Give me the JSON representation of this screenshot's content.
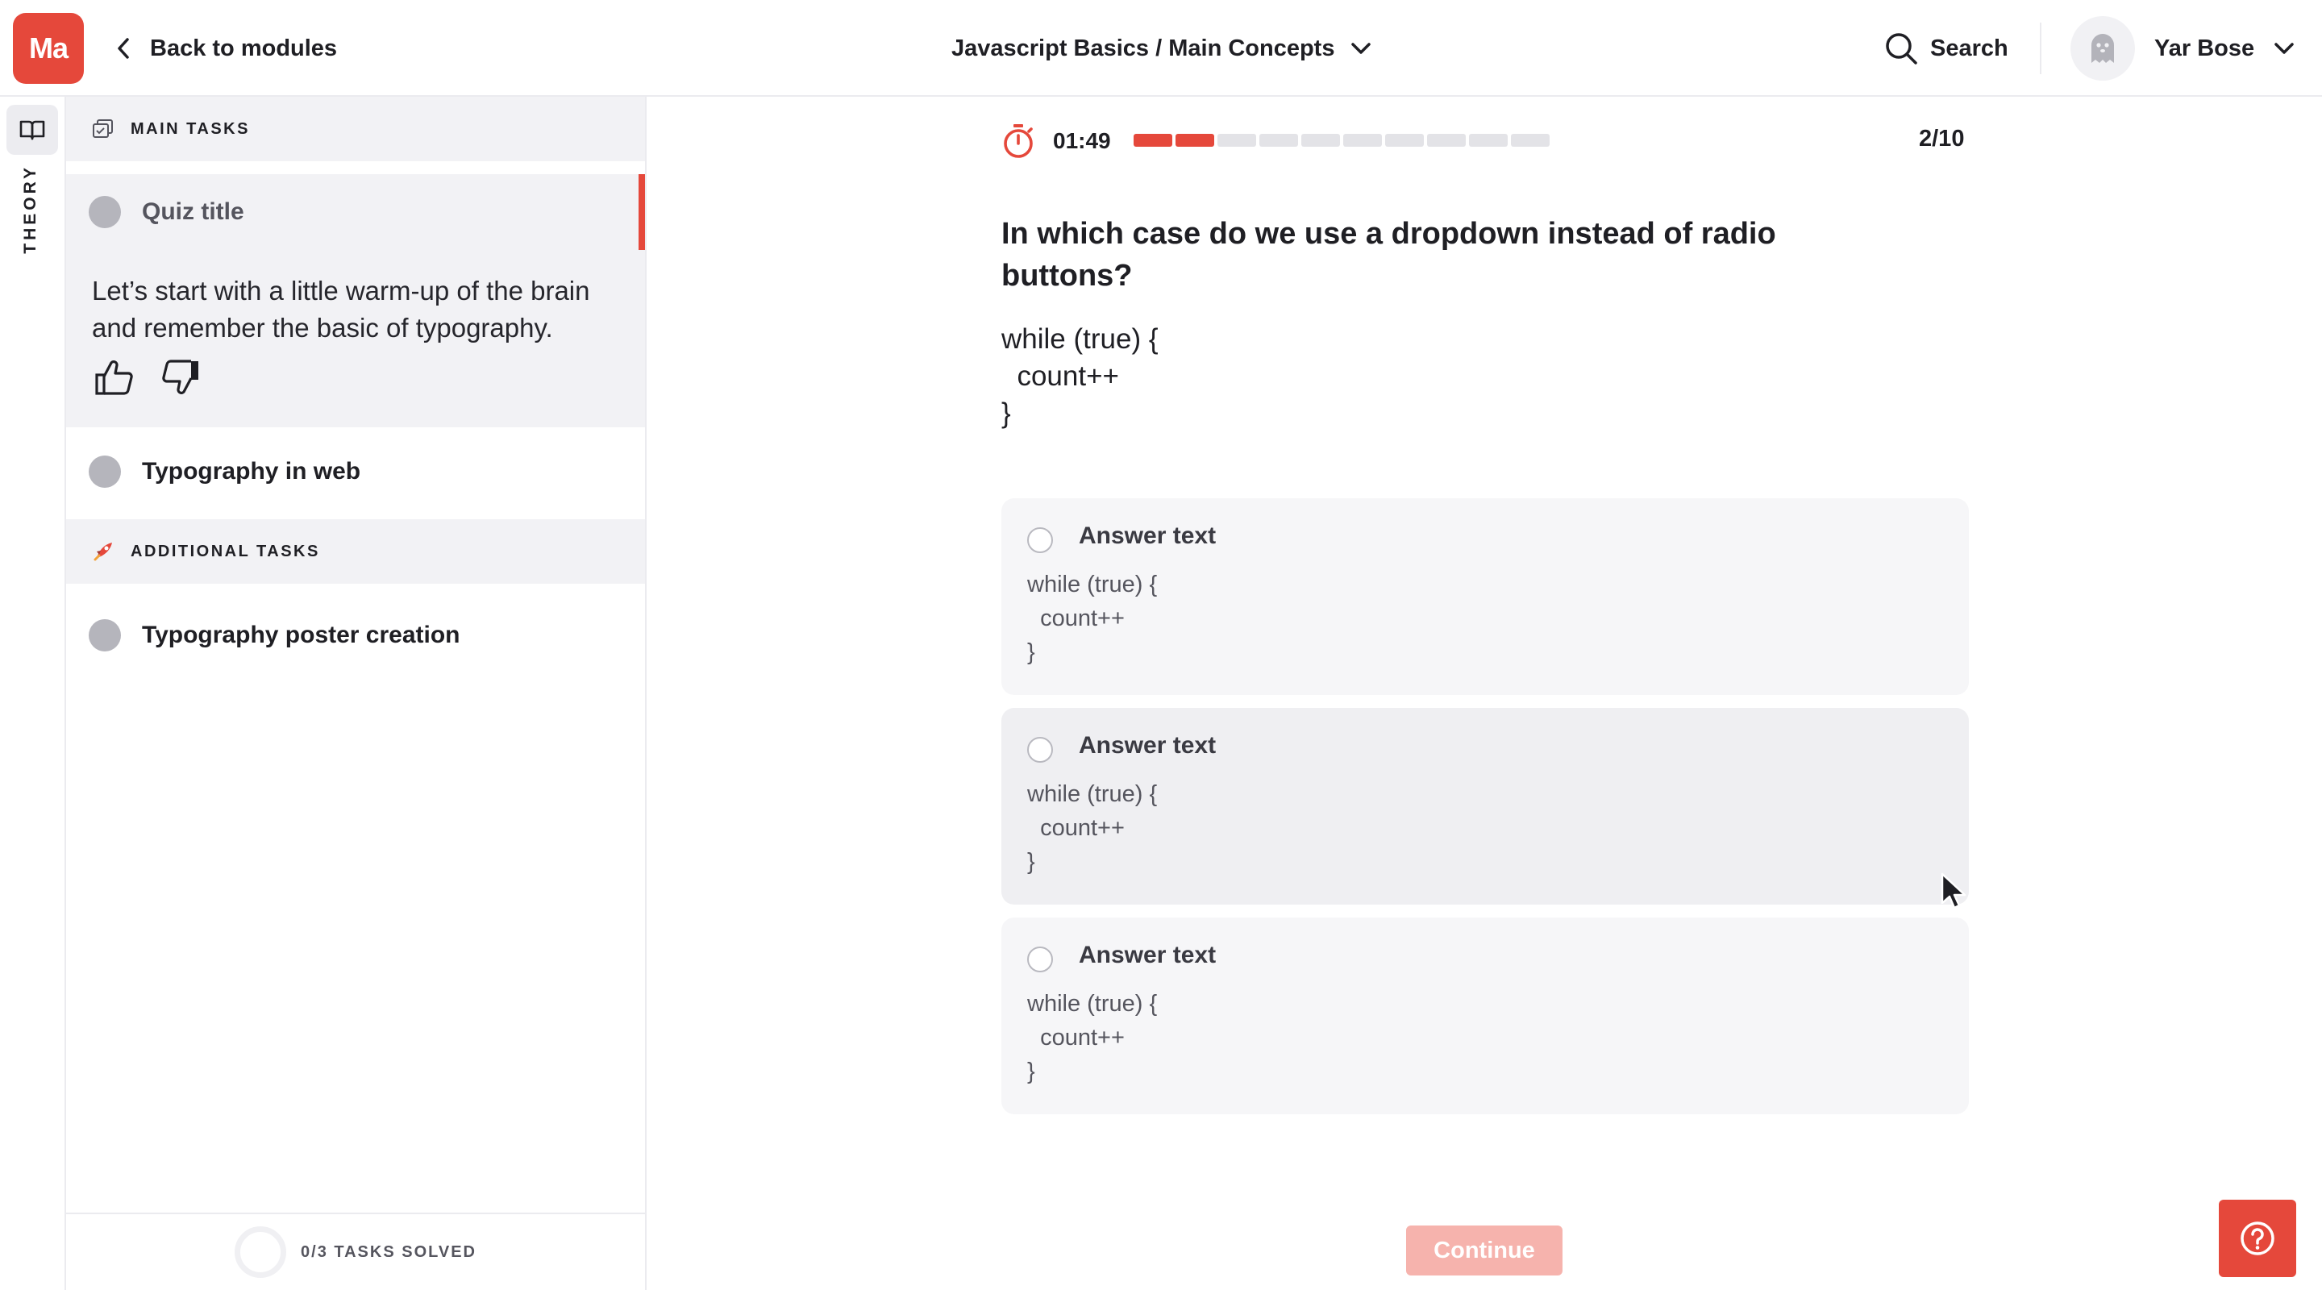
{
  "header": {
    "logo_text": "Ma",
    "back_label": "Back to modules",
    "breadcrumb": "Javascript Basics / Main Concepts",
    "search_label": "Search",
    "user_name": "Yar Bose"
  },
  "rail": {
    "theory_label": "THEORY",
    "icon": "book-open-icon"
  },
  "sidebar": {
    "main_tasks_label": "MAIN TASKS",
    "additional_tasks_label": "ADDITIONAL TASKS",
    "tasks": [
      {
        "label": "Quiz title",
        "active": true
      },
      {
        "label": "Typography in web",
        "active": false
      }
    ],
    "additional": [
      {
        "label": "Typography poster creation"
      }
    ],
    "active_description": "Let’s start with a little warm-up of the brain and remember the basic of typography.",
    "footer_label": "0/3 TASKS SOLVED",
    "tasks_solved": 0,
    "tasks_total": 3
  },
  "quiz": {
    "timer": "01:49",
    "counter": "2/10",
    "progress_total": 10,
    "progress_done": 2,
    "question": "In which case do we use a dropdown instead of radio buttons?",
    "code": "while (true) {\n  count++\n}",
    "answers": [
      {
        "title": "Answer text",
        "code": "while (true) {\n  count++\n}"
      },
      {
        "title": "Answer text",
        "code": "while (true) {\n  count++\n}"
      },
      {
        "title": "Answer text",
        "code": "while (true) {\n  count++\n}"
      }
    ],
    "continue_label": "Continue"
  },
  "colors": {
    "accent": "#e5483b",
    "accent_disabled": "#f6b3ad",
    "panel": "#f2f2f5",
    "answer_bg": "#f6f6f8"
  }
}
